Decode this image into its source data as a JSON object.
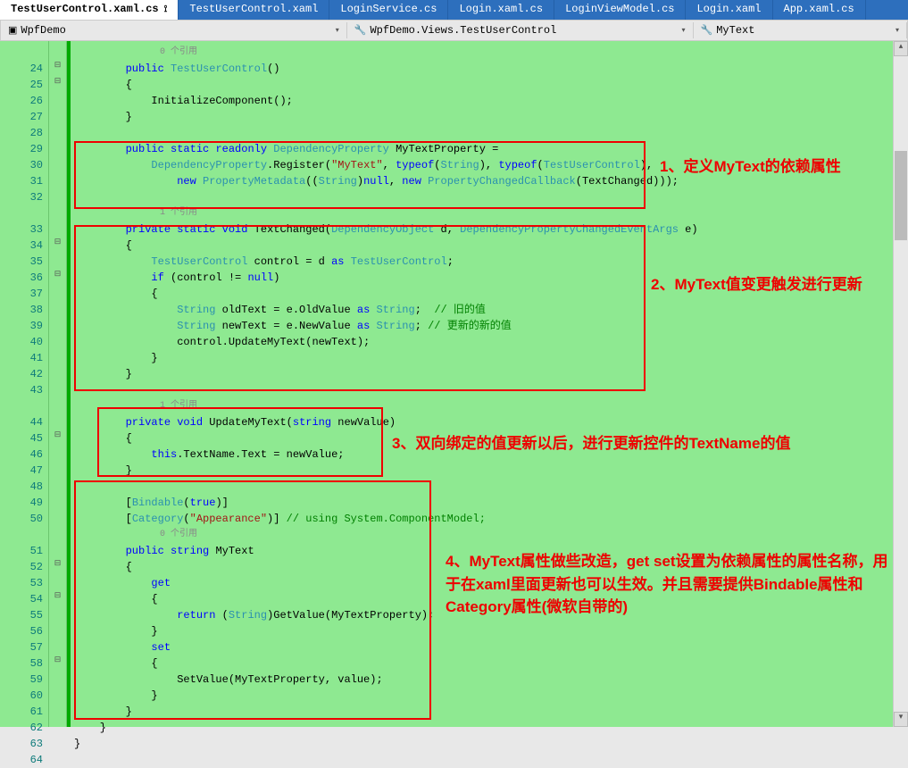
{
  "tabs": [
    {
      "label": "TestUserControl.xaml.cs",
      "active": true,
      "pinned": true
    },
    {
      "label": "TestUserControl.xaml"
    },
    {
      "label": "LoginService.cs"
    },
    {
      "label": "Login.xaml.cs"
    },
    {
      "label": "LoginViewModel.cs"
    },
    {
      "label": "Login.xaml"
    },
    {
      "label": "App.xaml.cs"
    }
  ],
  "nav": {
    "project": "WpfDemo",
    "type": "WpfDemo.Views.TestUserControl",
    "member": "MyText"
  },
  "lineStart": 24,
  "lineEnd": 64,
  "refHints": {
    "0": "0 个引用",
    "1": "1 个引用",
    "2": "1 个引用",
    "3": "0 个引用"
  },
  "code": {
    "l24": "        public TestUserControl()",
    "l25": "        {",
    "l26": "            InitializeComponent();",
    "l27": "        }",
    "l28": "",
    "l29": "        public static readonly DependencyProperty MyTextProperty =",
    "l30": "            DependencyProperty.Register(\"MyText\", typeof(String), typeof(TestUserControl),",
    "l31": "                new PropertyMetadata((String)null, new PropertyChangedCallback(TextChanged)));",
    "l32": "",
    "l33": "        private static void TextChanged(DependencyObject d, DependencyPropertyChangedEventArgs e)",
    "l34": "        {",
    "l35": "            TestUserControl control = d as TestUserControl;",
    "l36": "            if (control != null)",
    "l37": "            {",
    "l38": "                String oldText = e.OldValue as String;  // 旧的值",
    "l39": "                String newText = e.NewValue as String; // 更新的新的值",
    "l40": "                control.UpdateMyText(newText);",
    "l41": "            }",
    "l42": "        }",
    "l43": "",
    "l44": "        private void UpdateMyText(string newValue)",
    "l45": "        {",
    "l46": "            this.TextName.Text = newValue;",
    "l47": "        }",
    "l48": "",
    "l49": "        [Bindable(true)]",
    "l50": "        [Category(\"Appearance\")] // using System.ComponentModel;",
    "l51": "        public string MyText",
    "l52": "        {",
    "l53": "            get",
    "l54": "            {",
    "l55": "                return (String)GetValue(MyTextProperty);",
    "l56": "            }",
    "l57": "            set",
    "l58": "            {",
    "l59": "                SetValue(MyTextProperty, value);",
    "l60": "            }",
    "l61": "        }",
    "l62": "    }",
    "l63": "}",
    "l64": ""
  },
  "annotations": {
    "a1": "1、定义MyText的依赖属性",
    "a2": "2、MyText值变更触发进行更新",
    "a3": "3、双向绑定的值更新以后，进行更新控件的TextName的值",
    "a4": "4、MyText属性做些改造，get set设置为依赖属性的属性名称，用于在xaml里面更新也可以生效。并且需要提供Bindable属性和Category属性(微软自带的)"
  }
}
